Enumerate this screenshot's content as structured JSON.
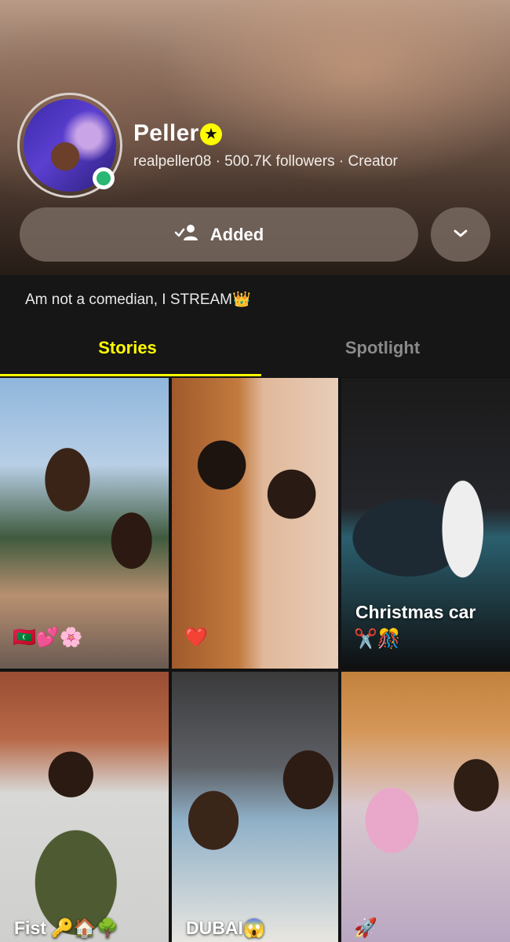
{
  "profile": {
    "name": "Peller",
    "verified_badge": "★",
    "meta": "realpeller08 · 500.7K followers · Creator",
    "online": true,
    "bio": "Am not a comedian, I STREAM👑"
  },
  "actions": {
    "added_icon": "✓👤",
    "added_label": "Added",
    "more_icon": "chevron-down-icon"
  },
  "tabs": [
    {
      "label": "Stories",
      "active": true
    },
    {
      "label": "Spotlight",
      "active": false
    }
  ],
  "stories": [
    {
      "caption": "",
      "emoji": "🇲🇻💕🌸"
    },
    {
      "caption": "",
      "emoji": "❤️"
    },
    {
      "caption": "Christmas car",
      "emoji": "✂️🎊"
    },
    {
      "caption": "Fist 🔑🏠🌳",
      "emoji": ""
    },
    {
      "caption": "DUBAI😱",
      "emoji": ""
    },
    {
      "caption": "",
      "emoji": "🚀"
    }
  ],
  "colors": {
    "accent": "#fffc00",
    "online": "#2ab673",
    "background": "#121212"
  }
}
